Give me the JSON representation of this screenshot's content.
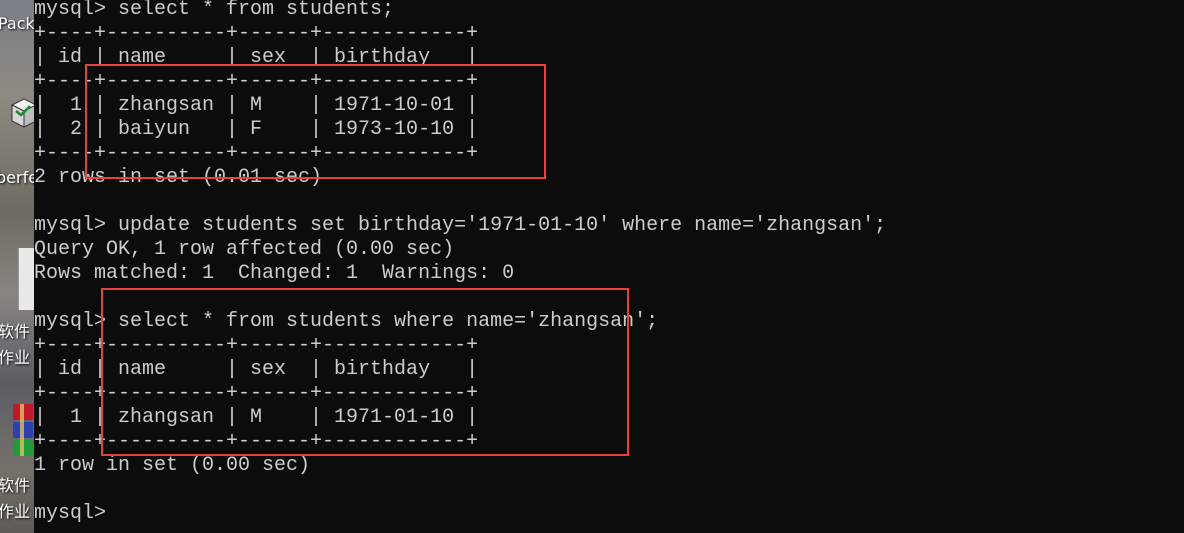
{
  "desktop": {
    "labels": [
      "Pack",
      "berfe",
      "软件",
      "作业",
      "软件",
      "作业"
    ]
  },
  "terminal": {
    "lines": [
      "mysql> select * from students;",
      "+----+----------+------+------------+",
      "| id | name     | sex  | birthday   |",
      "+----+----------+------+------------+",
      "|  1 | zhangsan | M    | 1971-10-01 |",
      "|  2 | baiyun   | F    | 1973-10-10 |",
      "+----+----------+------+------------+",
      "2 rows in set (0.01 sec)",
      "",
      "mysql> update students set birthday='1971-01-10' where name='zhangsan';",
      "Query OK, 1 row affected (0.00 sec)",
      "Rows matched: 1  Changed: 1  Warnings: 0",
      "",
      "mysql> select * from students where name='zhangsan';",
      "+----+----------+------+------------+",
      "| id | name     | sex  | birthday   |",
      "+----+----------+------+------------+",
      "|  1 | zhangsan | M    | 1971-01-10 |",
      "+----+----------+------+------------+",
      "1 row in set (0.00 sec)",
      "",
      "mysql> "
    ]
  },
  "colors": {
    "terminal_bg": "#0c0c0c",
    "terminal_text": "#cccccc",
    "highlight_box": "#e8413a"
  }
}
